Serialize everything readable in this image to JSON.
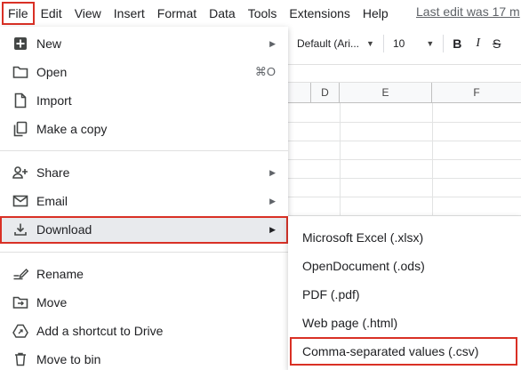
{
  "menubar": {
    "items": [
      "File",
      "Edit",
      "View",
      "Insert",
      "Format",
      "Data",
      "Tools",
      "Extensions",
      "Help"
    ],
    "last_edit": "Last edit was 17 m"
  },
  "toolbar": {
    "font": "Default (Ari...",
    "size": "10",
    "bold": "B",
    "italic": "I",
    "strike": "S"
  },
  "grid": {
    "columns": [
      "D",
      "E",
      "F"
    ]
  },
  "file_menu": {
    "items": [
      {
        "label": "New",
        "icon": "plus-box-icon",
        "submenu": true
      },
      {
        "label": "Open",
        "icon": "folder-icon",
        "shortcut": "⌘O"
      },
      {
        "label": "Import",
        "icon": "file-icon"
      },
      {
        "label": "Make a copy",
        "icon": "copy-icon"
      },
      {
        "label": "Share",
        "icon": "share-person-icon",
        "submenu": true
      },
      {
        "label": "Email",
        "icon": "email-icon",
        "submenu": true
      },
      {
        "label": "Download",
        "icon": "download-icon",
        "submenu": true,
        "active": true
      },
      {
        "label": "Rename",
        "icon": "rename-icon"
      },
      {
        "label": "Move",
        "icon": "move-folder-icon"
      },
      {
        "label": "Add a shortcut to Drive",
        "icon": "drive-shortcut-icon"
      },
      {
        "label": "Move to bin",
        "icon": "trash-icon"
      }
    ],
    "arrow": "▶"
  },
  "download_submenu": {
    "items": [
      {
        "label": "Microsoft Excel (.xlsx)"
      },
      {
        "label": "OpenDocument (.ods)"
      },
      {
        "label": "PDF (.pdf)"
      },
      {
        "label": "Web page (.html)"
      },
      {
        "label": "Comma-separated values (.csv)",
        "highlighted": true
      }
    ]
  },
  "colors": {
    "highlight_border": "#d93025",
    "active_bg": "#e8eaed",
    "text": "#202124",
    "icon": "#444746"
  }
}
